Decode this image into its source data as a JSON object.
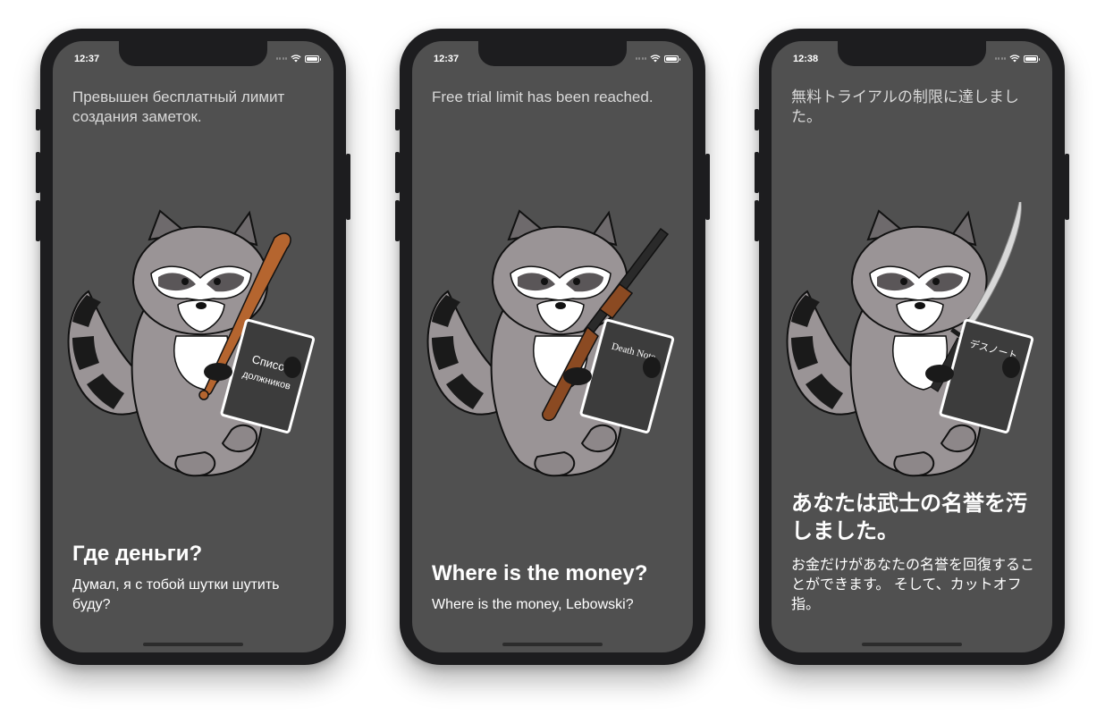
{
  "phones": [
    {
      "time": "12:37",
      "notice": "Превышен бесплатный лимит создания заметок.",
      "headline": "Где деньги?",
      "subtext": "Думал, я с тобой шутки шутить буду?",
      "book_line1": "Список",
      "book_line2": "должников",
      "weapon": "baseball-bat"
    },
    {
      "time": "12:37",
      "notice": "Free trial limit has been reached.",
      "headline": "Where is the money?",
      "subtext": "Where is the money, Lebowski?",
      "book_line1": "Death Note",
      "book_line2": "",
      "weapon": "shotgun"
    },
    {
      "time": "12:38",
      "notice": "無料トライアルの制限に達しました。",
      "headline": "あなたは武士の名誉を汚しました。",
      "subtext": "お金だけがあなたの名誉を回復することができます。 そして、カットオフ指。",
      "book_line1": "デスノート",
      "book_line2": "",
      "weapon": "katana"
    }
  ],
  "colors": {
    "screen_bg": "#505050",
    "raccoon_body": "#9a9496",
    "raccoon_dark": "#6e6a6c",
    "tail_stripe": "#1a1a1a",
    "book": "#3c3c3c"
  }
}
